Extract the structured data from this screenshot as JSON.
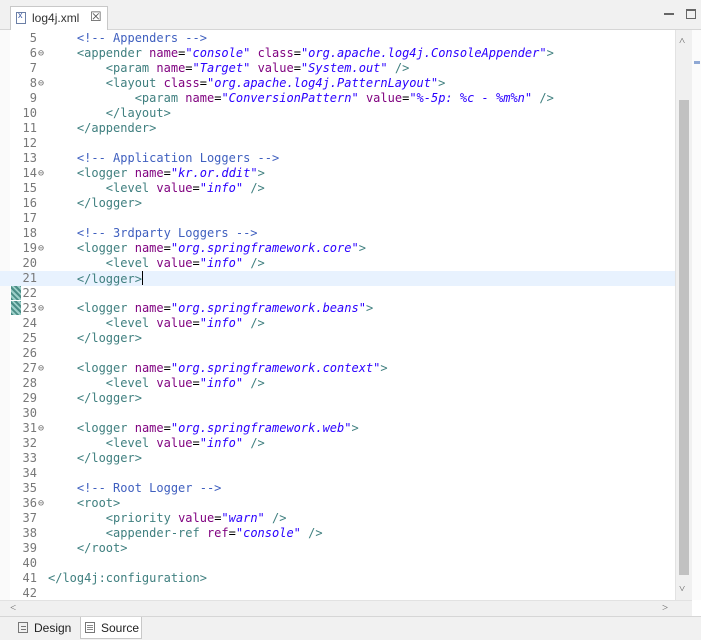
{
  "tab": {
    "title": "log4j.xml",
    "close": "☒"
  },
  "bottom_tabs": [
    {
      "label": "Design"
    },
    {
      "label": "Source"
    }
  ],
  "colors": {
    "tag": "#3f7f7f",
    "attribute": "#7f007f",
    "value": "#2a00ff",
    "comment": "#3f5fbf",
    "current_line": "#e8f2fe"
  },
  "editor": {
    "current_line": 21,
    "lines": [
      {
        "n": "5",
        "fold": "",
        "code": "    <!-- Appenders -->"
      },
      {
        "n": "6",
        "fold": "⊖",
        "code": "    <appender name=\"console\" class=\"org.apache.log4j.ConsoleAppender\">"
      },
      {
        "n": "7",
        "fold": "",
        "code": "        <param name=\"Target\" value=\"System.out\" />"
      },
      {
        "n": "8",
        "fold": "⊖",
        "code": "        <layout class=\"org.apache.log4j.PatternLayout\">"
      },
      {
        "n": "9",
        "fold": "",
        "code": "            <param name=\"ConversionPattern\" value=\"%-5p: %c - %m%n\" />"
      },
      {
        "n": "10",
        "fold": "",
        "code": "        </layout>"
      },
      {
        "n": "11",
        "fold": "",
        "code": "    </appender>"
      },
      {
        "n": "12",
        "fold": "",
        "code": ""
      },
      {
        "n": "13",
        "fold": "",
        "code": "    <!-- Application Loggers -->"
      },
      {
        "n": "14",
        "fold": "⊖",
        "code": "    <logger name=\"kr.or.ddit\">"
      },
      {
        "n": "15",
        "fold": "",
        "code": "        <level value=\"info\" />"
      },
      {
        "n": "16",
        "fold": "",
        "code": "    </logger>"
      },
      {
        "n": "17",
        "fold": "",
        "code": ""
      },
      {
        "n": "18",
        "fold": "",
        "code": "    <!-- 3rdparty Loggers -->"
      },
      {
        "n": "19",
        "fold": "⊖",
        "code": "    <logger name=\"org.springframework.core\">"
      },
      {
        "n": "20",
        "fold": "",
        "code": "        <level value=\"info\" />"
      },
      {
        "n": "21",
        "fold": "",
        "code": "    </logger>"
      },
      {
        "n": "22",
        "fold": "",
        "code": ""
      },
      {
        "n": "23",
        "fold": "⊖",
        "code": "    <logger name=\"org.springframework.beans\">"
      },
      {
        "n": "24",
        "fold": "",
        "code": "        <level value=\"info\" />"
      },
      {
        "n": "25",
        "fold": "",
        "code": "    </logger>"
      },
      {
        "n": "26",
        "fold": "",
        "code": ""
      },
      {
        "n": "27",
        "fold": "⊖",
        "code": "    <logger name=\"org.springframework.context\">"
      },
      {
        "n": "28",
        "fold": "",
        "code": "        <level value=\"info\" />"
      },
      {
        "n": "29",
        "fold": "",
        "code": "    </logger>"
      },
      {
        "n": "30",
        "fold": "",
        "code": ""
      },
      {
        "n": "31",
        "fold": "⊖",
        "code": "    <logger name=\"org.springframework.web\">"
      },
      {
        "n": "32",
        "fold": "",
        "code": "        <level value=\"info\" />"
      },
      {
        "n": "33",
        "fold": "",
        "code": "    </logger>"
      },
      {
        "n": "34",
        "fold": "",
        "code": ""
      },
      {
        "n": "35",
        "fold": "",
        "code": "    <!-- Root Logger -->"
      },
      {
        "n": "36",
        "fold": "⊖",
        "code": "    <root>"
      },
      {
        "n": "37",
        "fold": "",
        "code": "        <priority value=\"warn\" />"
      },
      {
        "n": "38",
        "fold": "",
        "code": "        <appender-ref ref=\"console\" />"
      },
      {
        "n": "39",
        "fold": "",
        "code": "    </root>"
      },
      {
        "n": "40",
        "fold": "",
        "code": ""
      },
      {
        "n": "41",
        "fold": "",
        "code": "</log4j:configuration>"
      },
      {
        "n": "42",
        "fold": "",
        "code": ""
      }
    ]
  }
}
